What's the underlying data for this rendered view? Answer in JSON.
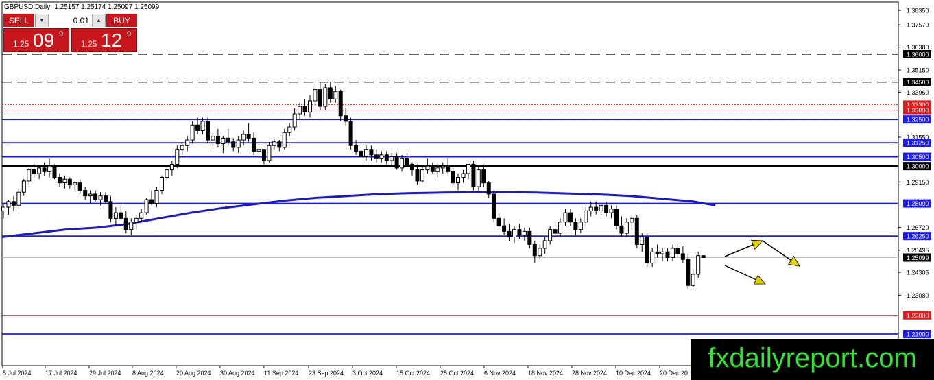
{
  "header": {
    "symbol_label": "GBPUSD,Daily",
    "ohlc": "1.25157 1.25174 1.25097 1.25099"
  },
  "trade_panel": {
    "sell_label": "SELL",
    "buy_label": "BUY",
    "lot_value": "0.01",
    "sell_price": {
      "prefix": "1.25",
      "big": "09",
      "sup": "9"
    },
    "buy_price": {
      "prefix": "1.25",
      "big": "12",
      "sup": "9"
    }
  },
  "watermark": "fxdailyreport.com",
  "colors": {
    "level_blue": "#1a1aff",
    "level_black": "#000000",
    "level_red": "#e31b1b",
    "ma_blue": "#1a1acc",
    "arrow_yellow": "#e6d200",
    "price_tag_bg": "#000000"
  },
  "chart_data": {
    "type": "candlestick",
    "symbol": "GBPUSD",
    "timeframe": "Daily",
    "ylim": [
      1.21,
      1.3835
    ],
    "x_tick_labels": [
      "5 Jul 2024",
      "17 Jul 2024",
      "29 Jul 2024",
      "8 Aug 2024",
      "20 Aug 2024",
      "30 Aug 2024",
      "11 Sep 2024",
      "23 Sep 2024",
      "3 Oct 2024",
      "15 Oct 2024",
      "25 Oct 2024",
      "6 Nov 2024",
      "18 Nov 2024",
      "28 Nov 2024",
      "10 Dec 2024",
      "20 Dec 20"
    ],
    "y_tick_labels": [
      "1.38350",
      "1.37570",
      "1.36380",
      "1.35150",
      "1.33960",
      "1.31550",
      "1.29150",
      "1.26720",
      "1.25495",
      "1.24305",
      "1.23080"
    ],
    "levels": [
      {
        "price": 1.36,
        "label": "1.36000",
        "style": "dashed",
        "color": "#000000"
      },
      {
        "price": 1.345,
        "label": "1.34500",
        "style": "dashed",
        "color": "#000000"
      },
      {
        "price": 1.333,
        "label": "1.33300",
        "style": "dotted",
        "color": "#e31b1b"
      },
      {
        "price": 1.33,
        "label": "1.33000",
        "style": "dotted",
        "color": "#e31b1b"
      },
      {
        "price": 1.325,
        "label": "1.32500",
        "style": "solid",
        "color": "#1a1aff"
      },
      {
        "price": 1.3125,
        "label": "1.31250",
        "style": "solid",
        "color": "#1a1aff"
      },
      {
        "price": 1.305,
        "label": "1.30500",
        "style": "solid",
        "color": "#1a1aff"
      },
      {
        "price": 1.3,
        "label": "1.30000",
        "style": "solid-thick",
        "color": "#000000"
      },
      {
        "price": 1.28,
        "label": "1.28000",
        "style": "solid",
        "color": "#1a1aff"
      },
      {
        "price": 1.2625,
        "label": "1.26250",
        "style": "solid",
        "color": "#1a1aff"
      },
      {
        "price": 1.22,
        "label": "1.22000",
        "style": "solid",
        "color": "#e31b1b"
      },
      {
        "price": 1.21,
        "label": "1.21000",
        "style": "solid",
        "color": "#1a1aff"
      }
    ],
    "current_price": {
      "price": 1.25099,
      "label": "1.25099"
    },
    "candles": [
      [
        1.276,
        1.28,
        1.272,
        1.278
      ],
      [
        1.278,
        1.282,
        1.274,
        1.281
      ],
      [
        1.281,
        1.284,
        1.276,
        1.279
      ],
      [
        1.279,
        1.288,
        1.277,
        1.286
      ],
      [
        1.286,
        1.293,
        1.284,
        1.292
      ],
      [
        1.292,
        1.299,
        1.29,
        1.298
      ],
      [
        1.298,
        1.301,
        1.294,
        1.296
      ],
      [
        1.296,
        1.3,
        1.293,
        1.299
      ],
      [
        1.299,
        1.302,
        1.295,
        1.297
      ],
      [
        1.297,
        1.304,
        1.294,
        1.3
      ],
      [
        1.3,
        1.301,
        1.293,
        1.294
      ],
      [
        1.294,
        1.296,
        1.289,
        1.291
      ],
      [
        1.291,
        1.295,
        1.288,
        1.293
      ],
      [
        1.293,
        1.294,
        1.288,
        1.29
      ],
      [
        1.29,
        1.292,
        1.287,
        1.291
      ],
      [
        1.291,
        1.293,
        1.285,
        1.287
      ],
      [
        1.287,
        1.289,
        1.282,
        1.284
      ],
      [
        1.284,
        1.287,
        1.28,
        1.285
      ],
      [
        1.285,
        1.287,
        1.281,
        1.282
      ],
      [
        1.282,
        1.286,
        1.279,
        1.284
      ],
      [
        1.284,
        1.286,
        1.28,
        1.281
      ],
      [
        1.281,
        1.284,
        1.27,
        1.272
      ],
      [
        1.272,
        1.278,
        1.268,
        1.275
      ],
      [
        1.275,
        1.279,
        1.271,
        1.272
      ],
      [
        1.272,
        1.276,
        1.264,
        1.266
      ],
      [
        1.266,
        1.272,
        1.263,
        1.27
      ],
      [
        1.27,
        1.274,
        1.266,
        1.272
      ],
      [
        1.272,
        1.277,
        1.27,
        1.275
      ],
      [
        1.275,
        1.283,
        1.274,
        1.282
      ],
      [
        1.282,
        1.287,
        1.279,
        1.28
      ],
      [
        1.28,
        1.289,
        1.278,
        1.287
      ],
      [
        1.287,
        1.295,
        1.285,
        1.294
      ],
      [
        1.294,
        1.3,
        1.292,
        1.298
      ],
      [
        1.298,
        1.303,
        1.295,
        1.301
      ],
      [
        1.301,
        1.311,
        1.299,
        1.309
      ],
      [
        1.309,
        1.313,
        1.306,
        1.311
      ],
      [
        1.311,
        1.316,
        1.308,
        1.314
      ],
      [
        1.314,
        1.324,
        1.312,
        1.322
      ],
      [
        1.322,
        1.326,
        1.317,
        1.319
      ],
      [
        1.319,
        1.326,
        1.317,
        1.324
      ],
      [
        1.324,
        1.326,
        1.312,
        1.314
      ],
      [
        1.314,
        1.318,
        1.309,
        1.316
      ],
      [
        1.316,
        1.32,
        1.31,
        1.312
      ],
      [
        1.312,
        1.316,
        1.307,
        1.315
      ],
      [
        1.315,
        1.32,
        1.311,
        1.313
      ],
      [
        1.313,
        1.315,
        1.308,
        1.31
      ],
      [
        1.31,
        1.316,
        1.307,
        1.314
      ],
      [
        1.314,
        1.319,
        1.311,
        1.317
      ],
      [
        1.317,
        1.323,
        1.313,
        1.315
      ],
      [
        1.315,
        1.318,
        1.306,
        1.308
      ],
      [
        1.308,
        1.312,
        1.305,
        1.309
      ],
      [
        1.309,
        1.309,
        1.301,
        1.303
      ],
      [
        1.303,
        1.313,
        1.302,
        1.311
      ],
      [
        1.311,
        1.315,
        1.309,
        1.313
      ],
      [
        1.313,
        1.314,
        1.308,
        1.31
      ],
      [
        1.31,
        1.32,
        1.309,
        1.318
      ],
      [
        1.318,
        1.323,
        1.316,
        1.321
      ],
      [
        1.321,
        1.331,
        1.319,
        1.328
      ],
      [
        1.328,
        1.334,
        1.325,
        1.332
      ],
      [
        1.332,
        1.336,
        1.327,
        1.329
      ],
      [
        1.329,
        1.338,
        1.326,
        1.335
      ],
      [
        1.335,
        1.344,
        1.331,
        1.341
      ],
      [
        1.341,
        1.345,
        1.33,
        1.332
      ],
      [
        1.332,
        1.344,
        1.33,
        1.342
      ],
      [
        1.342,
        1.345,
        1.334,
        1.336
      ],
      [
        1.336,
        1.343,
        1.334,
        1.34
      ],
      [
        1.34,
        1.341,
        1.324,
        1.327
      ],
      [
        1.327,
        1.331,
        1.322,
        1.324
      ],
      [
        1.324,
        1.326,
        1.309,
        1.311
      ],
      [
        1.311,
        1.314,
        1.306,
        1.308
      ],
      [
        1.308,
        1.312,
        1.304,
        1.305
      ],
      [
        1.305,
        1.311,
        1.303,
        1.309
      ],
      [
        1.309,
        1.311,
        1.303,
        1.306
      ],
      [
        1.306,
        1.309,
        1.302,
        1.304
      ],
      [
        1.304,
        1.308,
        1.302,
        1.306
      ],
      [
        1.306,
        1.308,
        1.301,
        1.303
      ],
      [
        1.303,
        1.307,
        1.3,
        1.305
      ],
      [
        1.305,
        1.307,
        1.298,
        1.299
      ],
      [
        1.299,
        1.306,
        1.297,
        1.304
      ],
      [
        1.304,
        1.307,
        1.3,
        1.301
      ],
      [
        1.301,
        1.302,
        1.295,
        1.298
      ],
      [
        1.298,
        1.301,
        1.29,
        1.292
      ],
      [
        1.292,
        1.3,
        1.291,
        1.298
      ],
      [
        1.298,
        1.304,
        1.296,
        1.3
      ],
      [
        1.3,
        1.302,
        1.296,
        1.297
      ],
      [
        1.297,
        1.301,
        1.294,
        1.299
      ],
      [
        1.299,
        1.302,
        1.296,
        1.3
      ],
      [
        1.3,
        1.304,
        1.296,
        1.297
      ],
      [
        1.297,
        1.299,
        1.289,
        1.291
      ],
      [
        1.291,
        1.296,
        1.287,
        1.294
      ],
      [
        1.294,
        1.298,
        1.291,
        1.296
      ],
      [
        1.296,
        1.3,
        1.293,
        1.301
      ],
      [
        1.301,
        1.303,
        1.287,
        1.289
      ],
      [
        1.289,
        1.3,
        1.287,
        1.298
      ],
      [
        1.298,
        1.301,
        1.289,
        1.291
      ],
      [
        1.291,
        1.292,
        1.283,
        1.285
      ],
      [
        1.285,
        1.287,
        1.27,
        1.272
      ],
      [
        1.272,
        1.275,
        1.266,
        1.268
      ],
      [
        1.268,
        1.272,
        1.263,
        1.265
      ],
      [
        1.265,
        1.269,
        1.26,
        1.262
      ],
      [
        1.262,
        1.268,
        1.259,
        1.266
      ],
      [
        1.266,
        1.269,
        1.261,
        1.263
      ],
      [
        1.263,
        1.267,
        1.26,
        1.265
      ],
      [
        1.265,
        1.267,
        1.256,
        1.258
      ],
      [
        1.258,
        1.26,
        1.248,
        1.252
      ],
      [
        1.252,
        1.258,
        1.25,
        1.256
      ],
      [
        1.256,
        1.262,
        1.253,
        1.26
      ],
      [
        1.26,
        1.268,
        1.258,
        1.266
      ],
      [
        1.266,
        1.27,
        1.262,
        1.264
      ],
      [
        1.264,
        1.272,
        1.262,
        1.27
      ],
      [
        1.27,
        1.277,
        1.268,
        1.275
      ],
      [
        1.275,
        1.277,
        1.268,
        1.27
      ],
      [
        1.27,
        1.272,
        1.263,
        1.266
      ],
      [
        1.266,
        1.272,
        1.264,
        1.27
      ],
      [
        1.27,
        1.278,
        1.268,
        1.276
      ],
      [
        1.276,
        1.281,
        1.273,
        1.278
      ],
      [
        1.278,
        1.281,
        1.274,
        1.276
      ],
      [
        1.276,
        1.28,
        1.274,
        1.279
      ],
      [
        1.279,
        1.281,
        1.273,
        1.275
      ],
      [
        1.275,
        1.279,
        1.272,
        1.277
      ],
      [
        1.277,
        1.279,
        1.266,
        1.268
      ],
      [
        1.268,
        1.273,
        1.262,
        1.264
      ],
      [
        1.264,
        1.272,
        1.262,
        1.27
      ],
      [
        1.27,
        1.274,
        1.266,
        1.272
      ],
      [
        1.272,
        1.274,
        1.256,
        1.258
      ],
      [
        1.258,
        1.264,
        1.254,
        1.262
      ],
      [
        1.262,
        1.264,
        1.246,
        1.248
      ],
      [
        1.248,
        1.256,
        1.246,
        1.254
      ],
      [
        1.254,
        1.258,
        1.251,
        1.253
      ],
      [
        1.253,
        1.256,
        1.249,
        1.254
      ],
      [
        1.254,
        1.256,
        1.249,
        1.251
      ],
      [
        1.251,
        1.258,
        1.249,
        1.256
      ],
      [
        1.256,
        1.259,
        1.251,
        1.253
      ],
      [
        1.253,
        1.257,
        1.248,
        1.25
      ],
      [
        1.25,
        1.253,
        1.234,
        1.236
      ],
      [
        1.236,
        1.244,
        1.235,
        1.242
      ],
      [
        1.242,
        1.254,
        1.24,
        1.252
      ],
      [
        1.252,
        1.252,
        1.251,
        1.251
      ]
    ],
    "ma_points": [
      [
        0,
        1.262
      ],
      [
        10,
        1.264
      ],
      [
        20,
        1.266
      ],
      [
        30,
        1.267
      ],
      [
        40,
        1.269
      ],
      [
        50,
        1.272
      ],
      [
        60,
        1.275
      ],
      [
        70,
        1.2775
      ],
      [
        80,
        1.2795
      ],
      [
        90,
        1.2815
      ],
      [
        100,
        1.283
      ],
      [
        110,
        1.284
      ],
      [
        120,
        1.285
      ],
      [
        130,
        1.2855
      ],
      [
        140,
        1.2858
      ],
      [
        150,
        1.286
      ],
      [
        160,
        1.286
      ],
      [
        170,
        1.2858
      ],
      [
        180,
        1.2853
      ],
      [
        190,
        1.2848
      ],
      [
        200,
        1.284
      ],
      [
        210,
        1.2825
      ],
      [
        220,
        1.281
      ],
      [
        227,
        1.279
      ]
    ],
    "forecast_arrows": [
      {
        "from": [
          1.251,
          0
        ],
        "to": [
          1.2605,
          8
        ]
      },
      {
        "from": [
          1.2605,
          9
        ],
        "to": [
          1.246,
          17
        ]
      },
      {
        "from": [
          1.247,
          0
        ],
        "to": [
          1.2385,
          17
        ]
      }
    ]
  }
}
